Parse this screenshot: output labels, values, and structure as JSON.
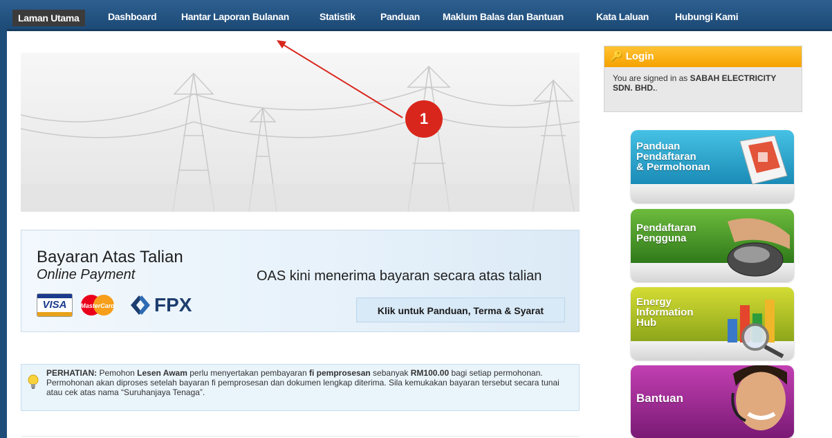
{
  "nav": {
    "items": [
      "Laman Utama",
      "Dashboard",
      "Hantar Laporan Bulanan",
      "Statistik",
      "Panduan",
      "Maklum Balas dan Bantuan",
      "Kata Laluan",
      "Hubungi Kami"
    ],
    "active": "Laman Utama"
  },
  "login": {
    "title": "Login",
    "prefix": "You are signed in as",
    "user": "SABAH ELECTRICITY SDN. BHD.",
    "suffix": "."
  },
  "payment": {
    "title": "Bayaran Atas Talian",
    "subtitle": "Online Payment",
    "message": "OAS kini menerima bayaran secara atas talian",
    "button": "Klik untuk Panduan, Terma & Syarat",
    "visa": "VISA",
    "mastercard": "MasterCard",
    "fpx": "FPX"
  },
  "notice": {
    "label": "PERHATIAN:",
    "t1": "Pemohon",
    "b1": "Lesen Awam",
    "t2": "perlu menyertakan pembayaran",
    "b2": "fi pemprosesan",
    "t3": "sebanyak",
    "b3": "RM100.00",
    "t4": "bagi setiap permohonan. Permohonan akan diproses setelah bayaran fi pemprosesan dan dokumen lengkap diterima. Sila kemukakan bayaran tersebut secara tunai atau cek atas nama “Suruhanjaya Tenaga”."
  },
  "tiles": {
    "t1": "Panduan\nPendaftaran\n& Permohonan",
    "t2": "Pendaftaran\nPengguna",
    "t3": "Energy\nInformation\nHub",
    "t4": "Bantuan"
  },
  "annotation": {
    "number": "1"
  },
  "colors": {
    "nav": "#1d4a76",
    "accent": "#d9261c",
    "login_header": "#f5a200"
  }
}
